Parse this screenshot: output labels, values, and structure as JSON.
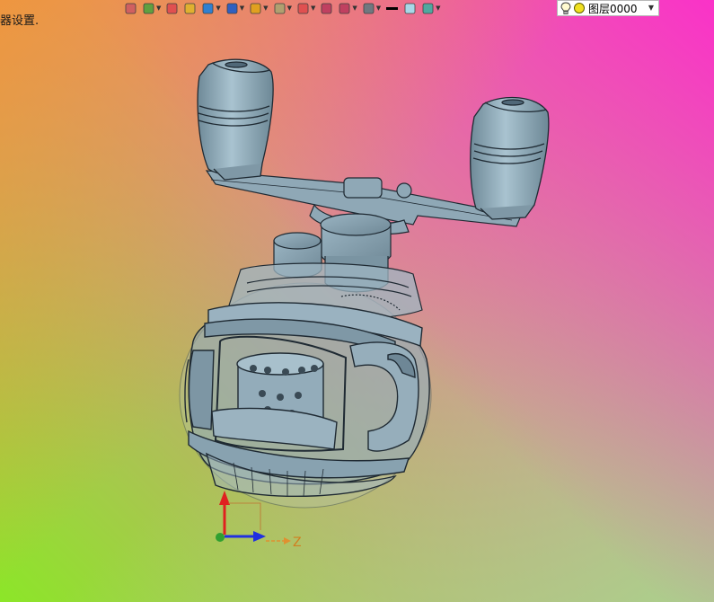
{
  "status_message": "器设置.",
  "toolbar": {
    "buttons": [
      {
        "icon": "exit-sketch-icon",
        "dropdown": false,
        "color": "#d06060"
      },
      {
        "icon": "sketch-dropdown-icon",
        "dropdown": true,
        "color": "#60a040"
      },
      {
        "icon": "pencil-icon",
        "dropdown": false,
        "color": "#e05050"
      },
      {
        "icon": "shaded-box-icon",
        "dropdown": false,
        "color": "#e0b030"
      },
      {
        "icon": "view-cube-icon",
        "dropdown": true,
        "color": "#3080d0"
      },
      {
        "icon": "view-orient-icon",
        "dropdown": true,
        "color": "#3060c0"
      },
      {
        "icon": "render-mode-icon",
        "dropdown": true,
        "color": "#e0a020"
      },
      {
        "icon": "zoom-fit-icon",
        "dropdown": true,
        "color": "#b0a070"
      },
      {
        "icon": "snap-icon",
        "dropdown": true,
        "color": "#e05050"
      },
      {
        "icon": "select-box-icon",
        "dropdown": false,
        "color": "#c04060"
      },
      {
        "icon": "section-icon",
        "dropdown": true,
        "color": "#c04060"
      },
      {
        "icon": "display-filter-icon",
        "dropdown": true,
        "color": "#707880"
      },
      {
        "icon": "line-style-icon",
        "dropdown": false,
        "color": "#000000"
      },
      {
        "icon": "fill-color-icon",
        "dropdown": false,
        "color": "#a8d8e8"
      },
      {
        "icon": "layer-color-icon",
        "dropdown": true,
        "color": "#50a8a0"
      }
    ]
  },
  "layer_selector": {
    "value": "图层0000",
    "bulb_icon": "lightbulb-icon",
    "state_icon": "layer-visible-icon"
  },
  "axis_triad": {
    "z_label": "Z",
    "colors": {
      "y": "#e02020",
      "x": "#2030e0",
      "z": "#e09030",
      "origin": "#30a030"
    }
  },
  "model": {
    "name": "baitcasting-reel-assembly-icon",
    "body_color": "#8faab8",
    "edge_color": "#1f2a33"
  }
}
